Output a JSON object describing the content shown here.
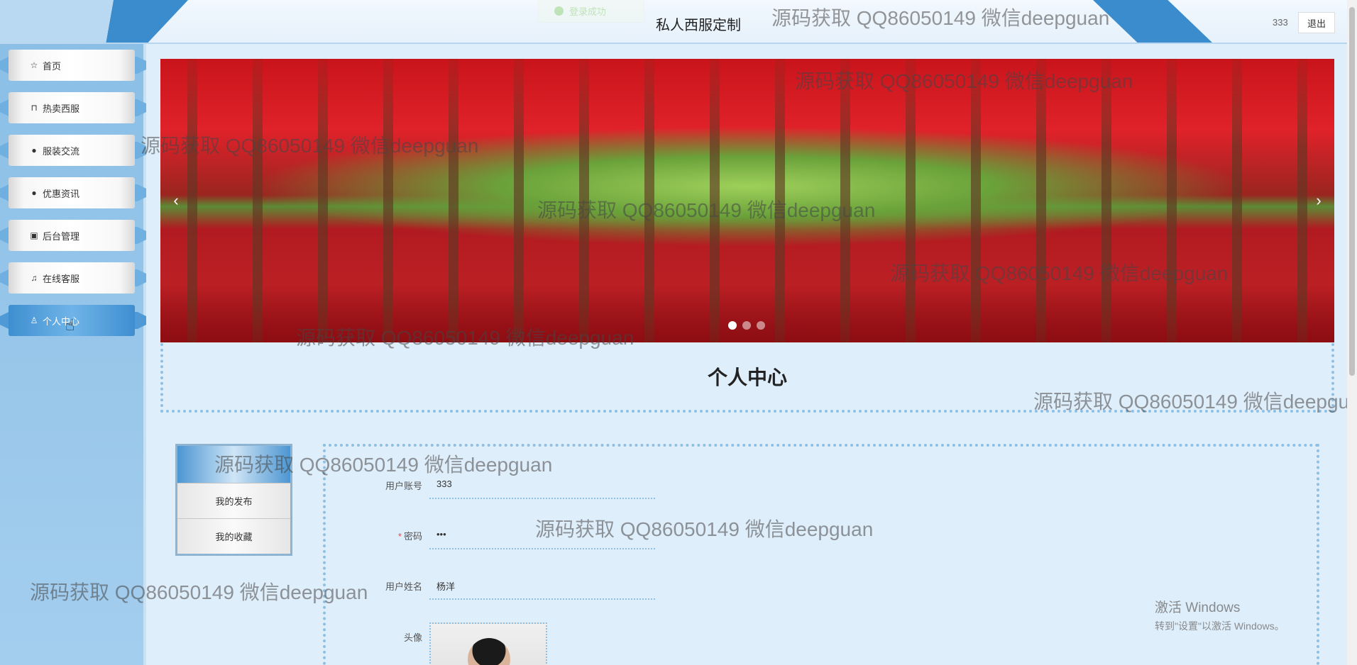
{
  "header": {
    "toast_text": "登录成功",
    "site_title": "私人西服定制",
    "user": "333",
    "logout_label": "退出"
  },
  "sidebar": {
    "items": [
      {
        "label": "首页",
        "icon": "star-icon",
        "glyph": "☆"
      },
      {
        "label": "热卖西服",
        "icon": "bag-icon",
        "glyph": "⊓"
      },
      {
        "label": "服装交流",
        "icon": "alert-circle-icon",
        "glyph": "●"
      },
      {
        "label": "优惠资讯",
        "icon": "question-circle-icon",
        "glyph": "●"
      },
      {
        "label": "后台管理",
        "icon": "briefcase-icon",
        "glyph": "▣"
      },
      {
        "label": "在线客服",
        "icon": "headset-icon",
        "glyph": "♫"
      },
      {
        "label": "个人中心",
        "icon": "user-icon",
        "glyph": "♙",
        "active": true
      }
    ]
  },
  "banner": {
    "prev": "‹",
    "next": "›",
    "slide_count": 3,
    "active_slide": 1
  },
  "section": {
    "title": "个人中心"
  },
  "tabs": {
    "items": [
      "我的发布",
      "我的收藏"
    ]
  },
  "form": {
    "username": {
      "label": "用户账号",
      "value": "333"
    },
    "password": {
      "label": "密码",
      "value": "•••",
      "required": "*"
    },
    "realname": {
      "label": "用户姓名",
      "value": "杨洋"
    },
    "avatar": {
      "label": "头像"
    }
  },
  "watermark": "源码获取 QQ86050149 微信deepguan",
  "windows_activation": {
    "line1": "激活 Windows",
    "line2": "转到\"设置\"以激活 Windows。"
  },
  "colors": {
    "accent": "#3a8ccd",
    "sidebar_bg": "#8bbfe6",
    "required": "#e04b4b"
  }
}
